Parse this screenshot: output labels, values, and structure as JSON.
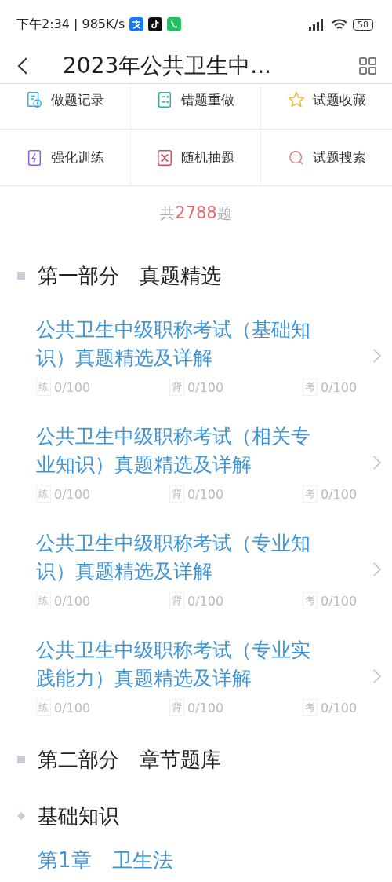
{
  "status_bar": {
    "time": "下午2:34 | 985K/s",
    "battery": "58"
  },
  "header": {
    "title": "2023年公共卫生中..."
  },
  "tools": [
    {
      "kind": "record",
      "label": "做题记录",
      "color": "#3aa6d9"
    },
    {
      "kind": "wrong",
      "label": "错题重做",
      "color": "#2fae9a"
    },
    {
      "kind": "star",
      "label": "试题收藏",
      "color": "#e9b93c"
    },
    {
      "kind": "bolt",
      "label": "强化训练",
      "color": "#8a5cd6"
    },
    {
      "kind": "shuffle",
      "label": "随机抽题",
      "color": "#d9485a"
    },
    {
      "kind": "search",
      "label": "试题搜索",
      "color": "#e07a7a"
    }
  ],
  "count": {
    "prefix": "共",
    "number": "2788",
    "suffix": "题"
  },
  "sections": [
    {
      "kind": "part",
      "title": "第一部分　真题精选",
      "items": [
        {
          "title": "公共卫生中级职称考试（基础知识）真题精选及详解",
          "stats": [
            {
              "label": "练",
              "value": "0/100"
            },
            {
              "label": "背",
              "value": "0/100"
            },
            {
              "label": "考",
              "value": "0/100"
            }
          ]
        },
        {
          "title": "公共卫生中级职称考试（相关专业知识）真题精选及详解",
          "stats": [
            {
              "label": "练",
              "value": "0/100"
            },
            {
              "label": "背",
              "value": "0/100"
            },
            {
              "label": "考",
              "value": "0/100"
            }
          ]
        },
        {
          "title": "公共卫生中级职称考试（专业知识）真题精选及详解",
          "stats": [
            {
              "label": "练",
              "value": "0/100"
            },
            {
              "label": "背",
              "value": "0/100"
            },
            {
              "label": "考",
              "value": "0/100"
            }
          ]
        },
        {
          "title": "公共卫生中级职称考试（专业实践能力）真题精选及详解",
          "stats": [
            {
              "label": "练",
              "value": "0/100"
            },
            {
              "label": "背",
              "value": "0/100"
            },
            {
              "label": "考",
              "value": "0/100"
            }
          ]
        }
      ]
    },
    {
      "kind": "part",
      "title": "第二部分　章节题库"
    },
    {
      "kind": "subpart",
      "title": "基础知识"
    },
    {
      "kind": "chapter",
      "title": "第1章　卫生法"
    }
  ]
}
